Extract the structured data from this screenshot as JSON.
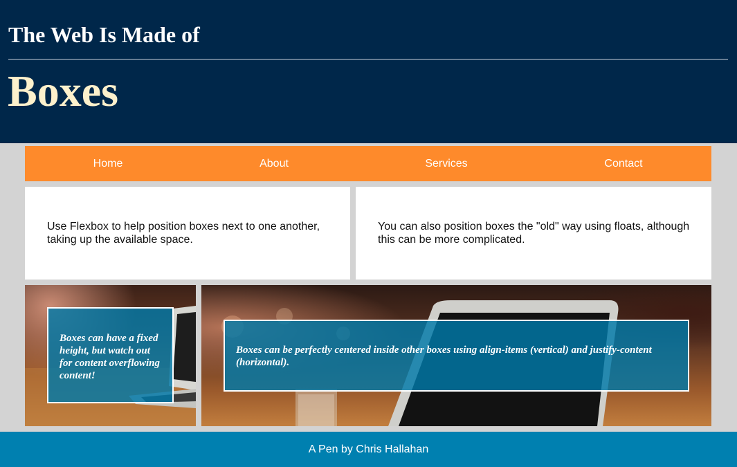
{
  "header": {
    "subtitle": "The Web Is Made of",
    "title": "Boxes"
  },
  "nav": {
    "items": [
      {
        "label": "Home"
      },
      {
        "label": "About"
      },
      {
        "label": "Services"
      },
      {
        "label": "Contact"
      }
    ]
  },
  "cards": {
    "flexbox_text": "Use Flexbox to help position boxes next to one another, taking up the available space.",
    "floats_text": "You can also position boxes the \"old\" way using floats, although this can be more complicated."
  },
  "boxes": {
    "fixed_height_text": "Boxes can have a fixed height, but watch out for content overflowing content!",
    "centered_text": "Boxes can be perfectly centered inside other boxes using align-items (vertical) and justify-content (horizontal)."
  },
  "footer": {
    "credit": "A Pen by Chris Hallahan"
  },
  "colors": {
    "header_bg": "#00274a",
    "title": "#fdf1cc",
    "nav_bg": "#fe8a2b",
    "overlay_bg": "#0079a8",
    "footer_bg": "#0080b0",
    "page_bg": "#d3d3d3"
  }
}
